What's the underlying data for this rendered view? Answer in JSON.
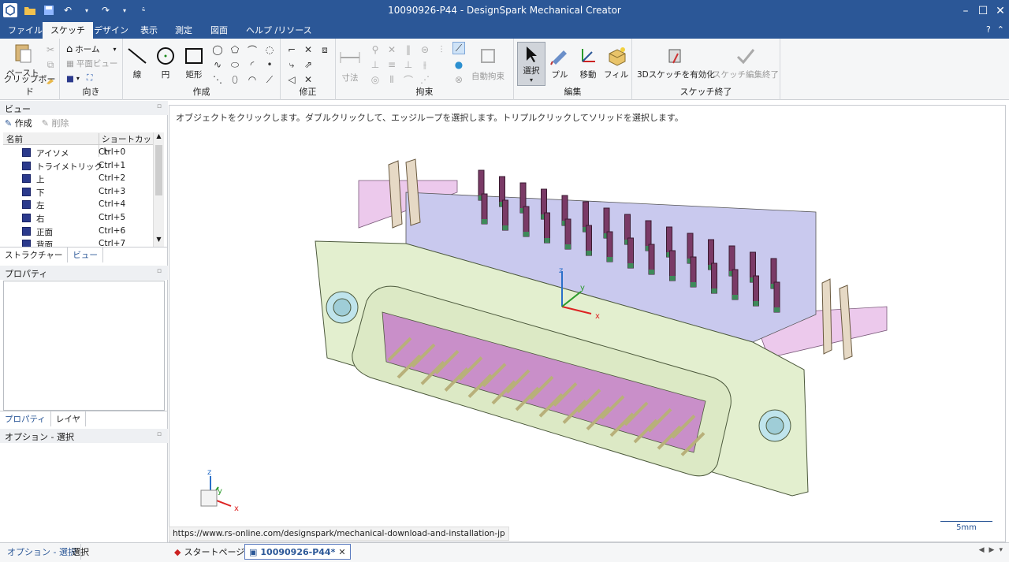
{
  "window": {
    "title": "10090926-P44 - DesignSpark Mechanical Creator"
  },
  "menu": {
    "tabs": [
      "ファイル",
      "スケッチ",
      "デザイン",
      "表示",
      "測定",
      "図面",
      "ヘルプ /リソース"
    ],
    "active_tab": "スケッチ"
  },
  "ribbon": {
    "clipboard": {
      "label": "クリップボード",
      "paste": "ペースト"
    },
    "orient": {
      "label": "向き",
      "home": "ホーム",
      "plan_view": "平面ビュー"
    },
    "create": {
      "label": "作成",
      "line": "線",
      "circle": "円",
      "rect": "矩形"
    },
    "modify": {
      "label": "修正"
    },
    "constraint": {
      "label": "拘束",
      "dimension": "寸法",
      "auto_constraint": "自動拘束"
    },
    "edit": {
      "label": "編集",
      "select": "選択",
      "pull": "プル",
      "move": "移動",
      "fill": "フィル"
    },
    "sketch_end": {
      "label": "スケッチ終了",
      "enable_3d": "3Dスケッチを有効化",
      "end_edit": "スケッチ編集終了"
    }
  },
  "views_panel": {
    "title": "ビュー",
    "create": "作成",
    "delete": "削除",
    "col_name": "名前",
    "col_shortcut": "ショートカット",
    "rows": [
      {
        "name": "アイソメ",
        "shortcut": "Ctrl+0"
      },
      {
        "name": "トライメトリック",
        "shortcut": "Ctrl+1"
      },
      {
        "name": "上",
        "shortcut": "Ctrl+2"
      },
      {
        "name": "下",
        "shortcut": "Ctrl+3"
      },
      {
        "name": "左",
        "shortcut": "Ctrl+4"
      },
      {
        "name": "右",
        "shortcut": "Ctrl+5"
      },
      {
        "name": "正面",
        "shortcut": "Ctrl+6"
      },
      {
        "name": "背面",
        "shortcut": "Ctrl+7"
      }
    ],
    "tabs": [
      "ストラクチャー",
      "ビュー"
    ]
  },
  "properties_panel": {
    "title": "プロパティ",
    "tabs": [
      "プロパティ",
      "レイヤ"
    ]
  },
  "options_panel": {
    "title": "オプション - 選択",
    "tabs": [
      "オプション - 選択",
      "選択"
    ]
  },
  "viewport": {
    "hint": "オブジェクトをクリックします。ダブルクリックして、エッジループを選択します。トリプルクリックしてソリッドを選択します。",
    "scale_label": "5mm",
    "url": "https://www.rs-online.com/designspark/mechanical-download-and-installation-jp"
  },
  "doc_tabs": [
    "スタートページ",
    "10090926-P44*"
  ],
  "colors": {
    "titlebar": "#2b5797",
    "ribbon_bg": "#f5f6f7",
    "model_green": "#e3efcf",
    "model_pink": "#e9c7e8",
    "model_lavender": "#c9c9ee"
  }
}
